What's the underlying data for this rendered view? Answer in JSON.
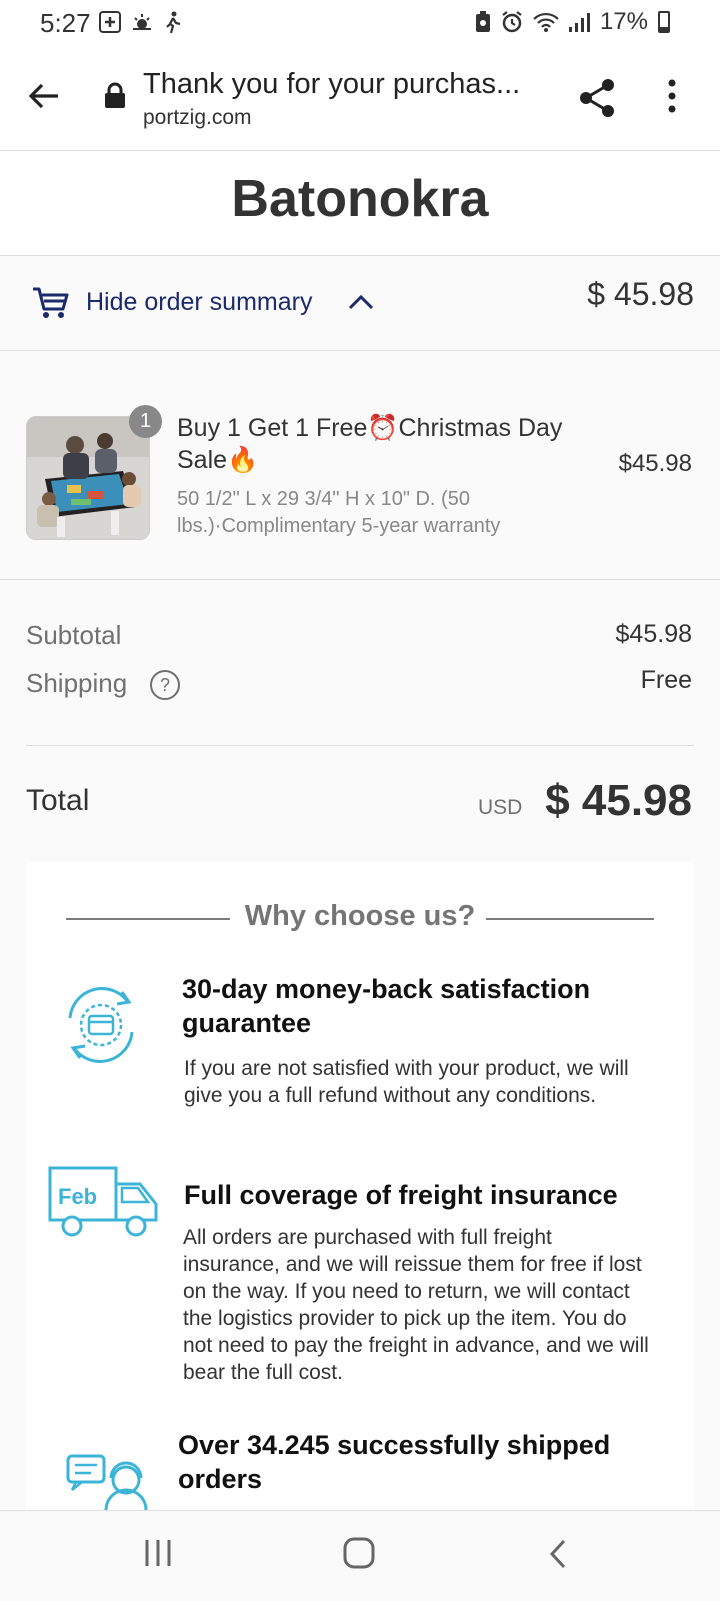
{
  "status": {
    "time": "5:27",
    "battery": "17%"
  },
  "browser": {
    "title": "Thank you for your purchas...",
    "domain": "portzig.com"
  },
  "store": {
    "name": "Batonokra"
  },
  "summary": {
    "toggle_label": "Hide order summary",
    "total": "$ 45.98"
  },
  "product": {
    "quantity": "1",
    "title": "Buy 1 Get 1 Free⏰Christmas Day Sale🔥",
    "description": "50 1/2\" L x 29 3/4\" H x 10\" D. (50 lbs.)·Complimentary 5-year warranty",
    "price": "$45.98"
  },
  "totals": {
    "subtotal_label": "Subtotal",
    "subtotal_value": "$45.98",
    "shipping_label": "Shipping",
    "shipping_value": "Free",
    "help_glyph": "?",
    "total_label": "Total",
    "currency": "USD",
    "total_value": "$ 45.98"
  },
  "why": {
    "title": "Why choose us?",
    "features": [
      {
        "icon": "refund-cycle-icon",
        "heading": "30-day money-back satisfaction guarantee",
        "text": "If you are not satisfied with your product, we will give you a full refund without any conditions."
      },
      {
        "icon": "delivery-truck-icon",
        "icon_label": "Feb",
        "heading": "Full coverage of freight insurance",
        "text": "All orders are purchased with full freight insurance, and we will reissue them for free if lost on the way. If you need to return, we will contact the logistics provider to pick up the item. You do not need to pay the freight in advance, and we will bear the full cost."
      },
      {
        "icon": "customer-support-icon",
        "heading": "Over 34.245 successfully shipped orders",
        "text": ""
      }
    ]
  },
  "colors": {
    "accent": "#1b2a6b",
    "icon_blue": "#3bb4d8"
  }
}
